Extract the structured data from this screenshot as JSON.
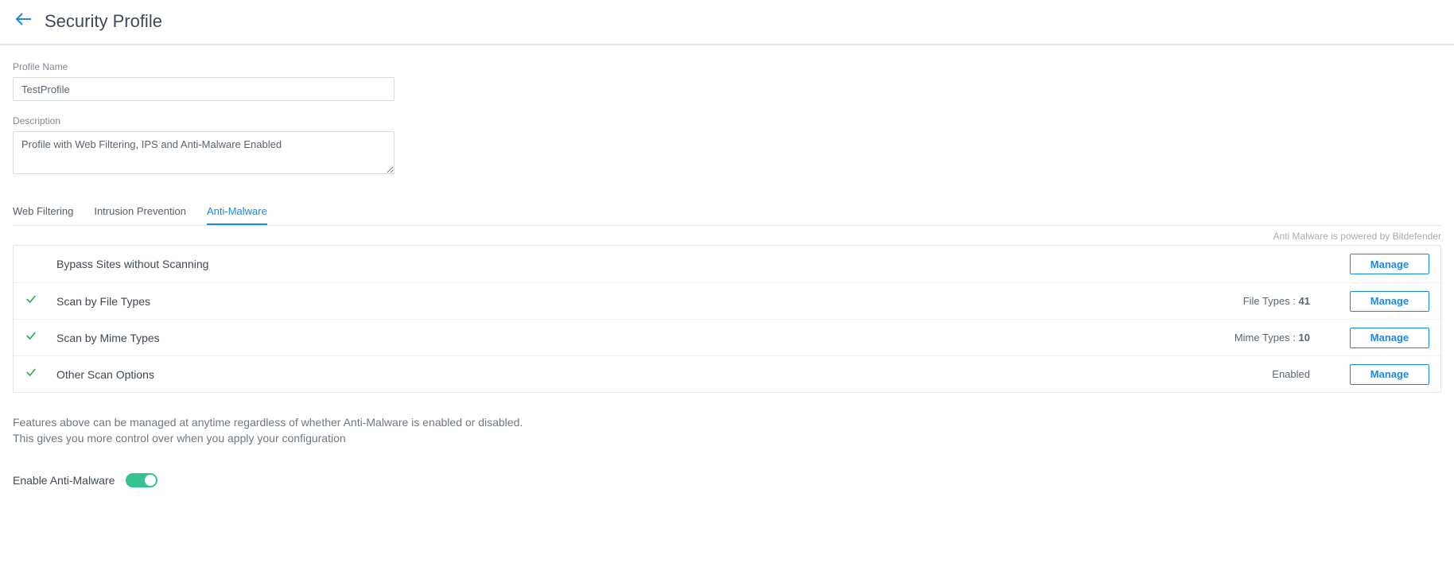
{
  "header": {
    "title": "Security Profile"
  },
  "form": {
    "profile_name_label": "Profile Name",
    "profile_name_value": "TestProfile",
    "description_label": "Description",
    "description_value": "Profile with Web Filtering, IPS and Anti-Malware Enabled"
  },
  "tabs": {
    "web_filtering": "Web Filtering",
    "intrusion_prevention": "Intrusion Prevention",
    "anti_malware": "Anti-Malware"
  },
  "powered_text": "Anti Malware is powered by Bitdefender",
  "rows": {
    "bypass": {
      "label": "Bypass Sites without Scanning",
      "info": "",
      "manage": "Manage",
      "has_check": false
    },
    "filetypes": {
      "label": "Scan by File Types",
      "info_prefix": "File Types : ",
      "info_value": "41",
      "manage": "Manage",
      "has_check": true
    },
    "mimetypes": {
      "label": "Scan by Mime Types",
      "info_prefix": "Mime Types : ",
      "info_value": "10",
      "manage": "Manage",
      "has_check": true
    },
    "otheropts": {
      "label": "Other Scan Options",
      "info": "Enabled",
      "manage": "Manage",
      "has_check": true
    }
  },
  "note_line1": "Features above can be managed at anytime regardless of whether Anti-Malware is enabled or disabled.",
  "note_line2": "This gives you more control over when you apply your configuration",
  "enable_label": "Enable Anti-Malware"
}
